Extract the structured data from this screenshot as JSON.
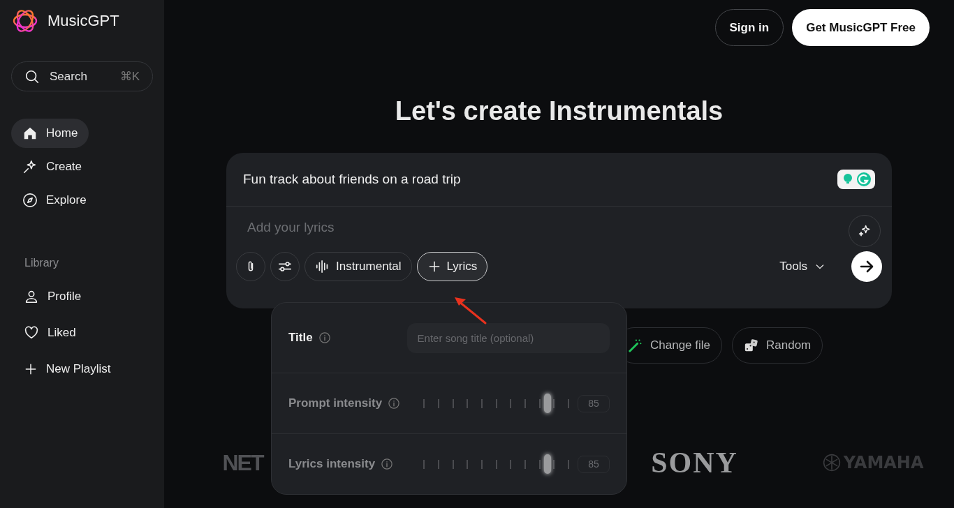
{
  "sidebar": {
    "brand": "MusicGPT",
    "search": {
      "placeholder": "Search",
      "shortcut": "⌘K"
    },
    "nav": [
      {
        "label": "Home",
        "selected": true
      },
      {
        "label": "Create",
        "selected": false
      },
      {
        "label": "Explore",
        "selected": false
      }
    ],
    "library": {
      "heading": "Library",
      "items": [
        {
          "label": "Profile"
        },
        {
          "label": "Liked"
        },
        {
          "label": "New Playlist"
        }
      ]
    }
  },
  "header": {
    "buttons": [
      {
        "label": "Sign in",
        "kind": "outline"
      },
      {
        "label": "Get MusicGPT Free",
        "kind": "solid"
      }
    ]
  },
  "heading": "Let's create Instrumentals",
  "composer": {
    "prompt": "Fun track about friends on a road trip",
    "lyrics_placeholder": "Add your lyrics",
    "toggles": [
      {
        "label": "Instrumental",
        "selected": false
      },
      {
        "label": "Lyrics",
        "selected": true
      }
    ],
    "tools": "Tools"
  },
  "chips": [
    {
      "label": "Change file"
    },
    {
      "label": "Random"
    }
  ],
  "logos": [
    "NET",
    "SONY",
    "YAMAHA"
  ],
  "popover": {
    "title": {
      "label": "Title",
      "placeholder": "Enter song title (optional)"
    },
    "sliders": [
      {
        "label": "Prompt intensity",
        "level": 0.85,
        "reading": "85"
      },
      {
        "label": "Lyrics intensity",
        "level": 0.85,
        "reading": "85"
      }
    ]
  }
}
